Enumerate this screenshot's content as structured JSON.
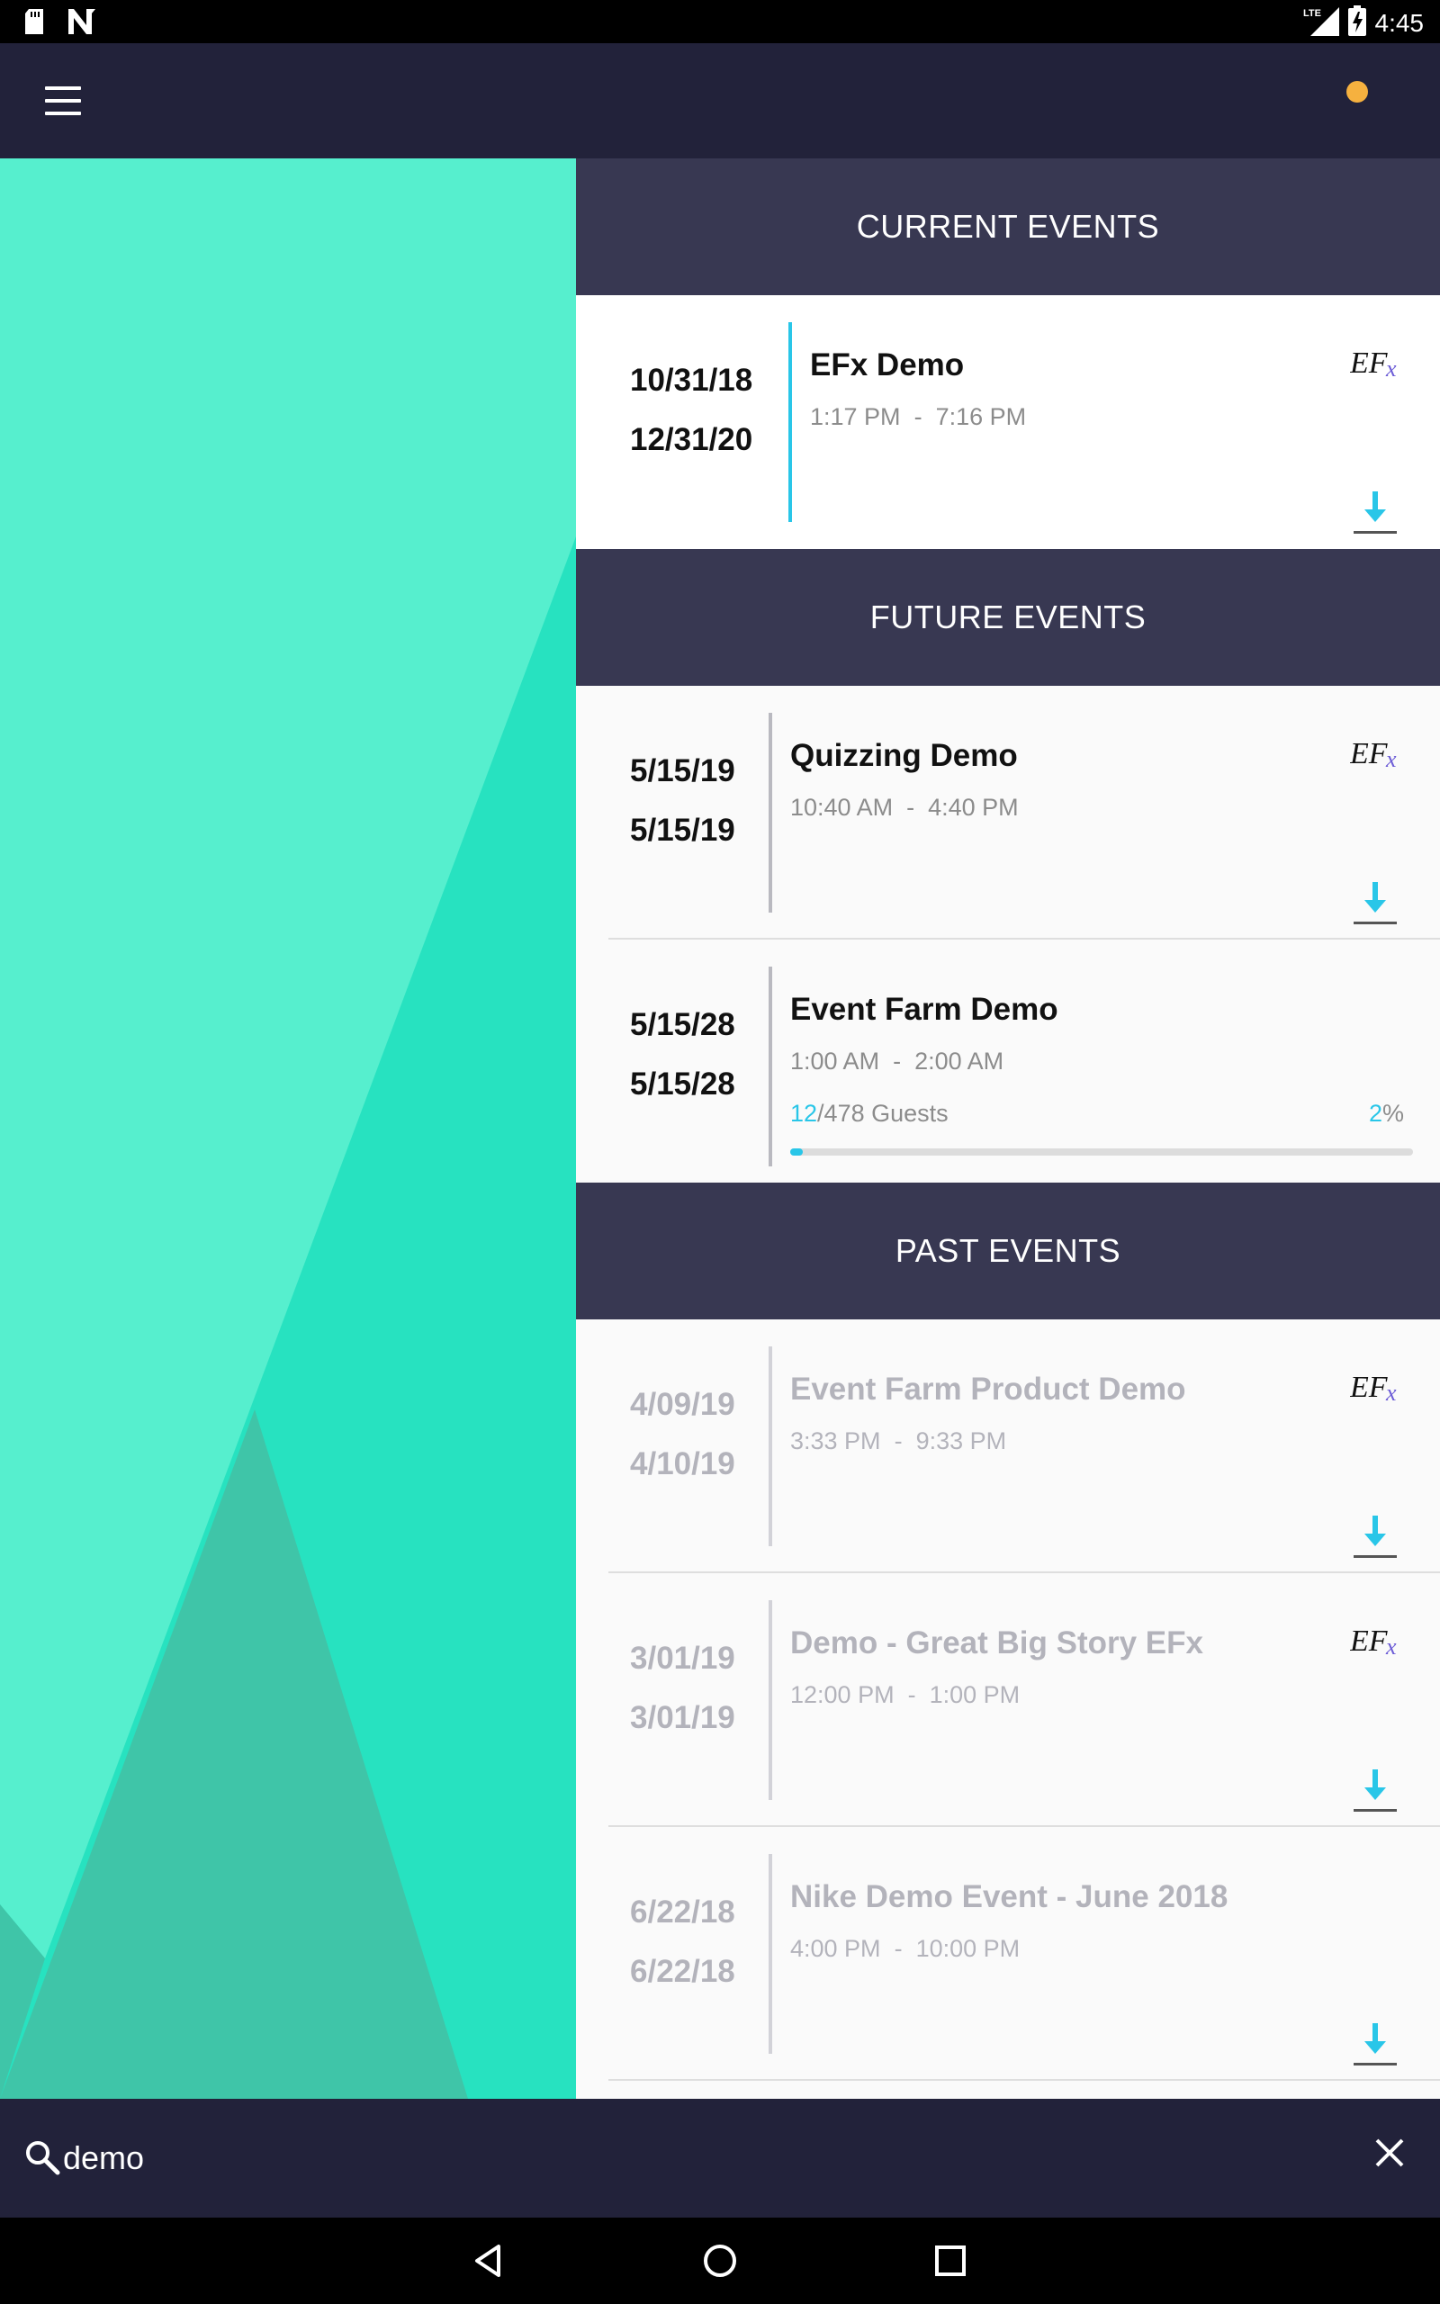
{
  "status_bar": {
    "time": "4:45",
    "network_label": "LTE",
    "left_icons": [
      "sd-card-icon",
      "n-notification-icon"
    ],
    "right_icons": [
      "lte-signal-icon",
      "battery-charging-icon"
    ]
  },
  "app_bar": {
    "menu_icon": "hamburger-menu-icon",
    "notification_dot_color": "#f6b13f"
  },
  "sections": {
    "current": {
      "header": "CURRENT EVENTS"
    },
    "future": {
      "header": "FUTURE EVENTS"
    },
    "past": {
      "header": "PAST EVENTS"
    }
  },
  "events": {
    "current": [
      {
        "start_date": "10/31/18",
        "end_date": "12/31/20",
        "title": "EFx Demo",
        "start_time": "1:17 PM",
        "end_time": "7:16 PM",
        "has_efx": true,
        "has_download": true
      }
    ],
    "future": [
      {
        "start_date": "5/15/19",
        "end_date": "5/15/19",
        "title": "Quizzing Demo",
        "start_time": "10:40 AM",
        "end_time": "4:40 PM",
        "has_efx": true,
        "has_download": true
      },
      {
        "start_date": "5/15/28",
        "end_date": "5/15/28",
        "title": "Event Farm Demo",
        "start_time": "1:00 AM",
        "end_time": "2:00 AM",
        "guests_checked": "12",
        "guests_total_label": "/478 Guests",
        "percent": "2",
        "percent_sign": "%",
        "progress_fraction": 0.02
      }
    ],
    "past": [
      {
        "start_date": "4/09/19",
        "end_date": "4/10/19",
        "title": "Event Farm Product Demo",
        "start_time": "3:33 PM",
        "end_time": "9:33 PM",
        "has_efx": true,
        "has_download": true
      },
      {
        "start_date": "3/01/19",
        "end_date": "3/01/19",
        "title": "Demo - Great Big Story EFx",
        "start_time": "12:00 PM",
        "end_time": "1:00 PM",
        "has_efx": true,
        "has_download": true
      },
      {
        "start_date": "6/22/18",
        "end_date": "6/22/18",
        "title": "Nike Demo Event - June 2018",
        "start_time": "4:00 PM",
        "end_time": "10:00 PM",
        "has_efx": false,
        "has_download": true
      }
    ]
  },
  "time_separator": "-",
  "efx_logo_text": "EFx",
  "search": {
    "value": "demo",
    "search_icon": "search-icon",
    "clear_icon": "close-icon"
  },
  "nav_bar": {
    "buttons": [
      "back-icon",
      "home-icon",
      "recents-icon"
    ]
  },
  "colors": {
    "accent": "#29c6e8",
    "header_bg": "#383852",
    "appbar_bg": "#22223a",
    "teal": "#27e2c0"
  }
}
